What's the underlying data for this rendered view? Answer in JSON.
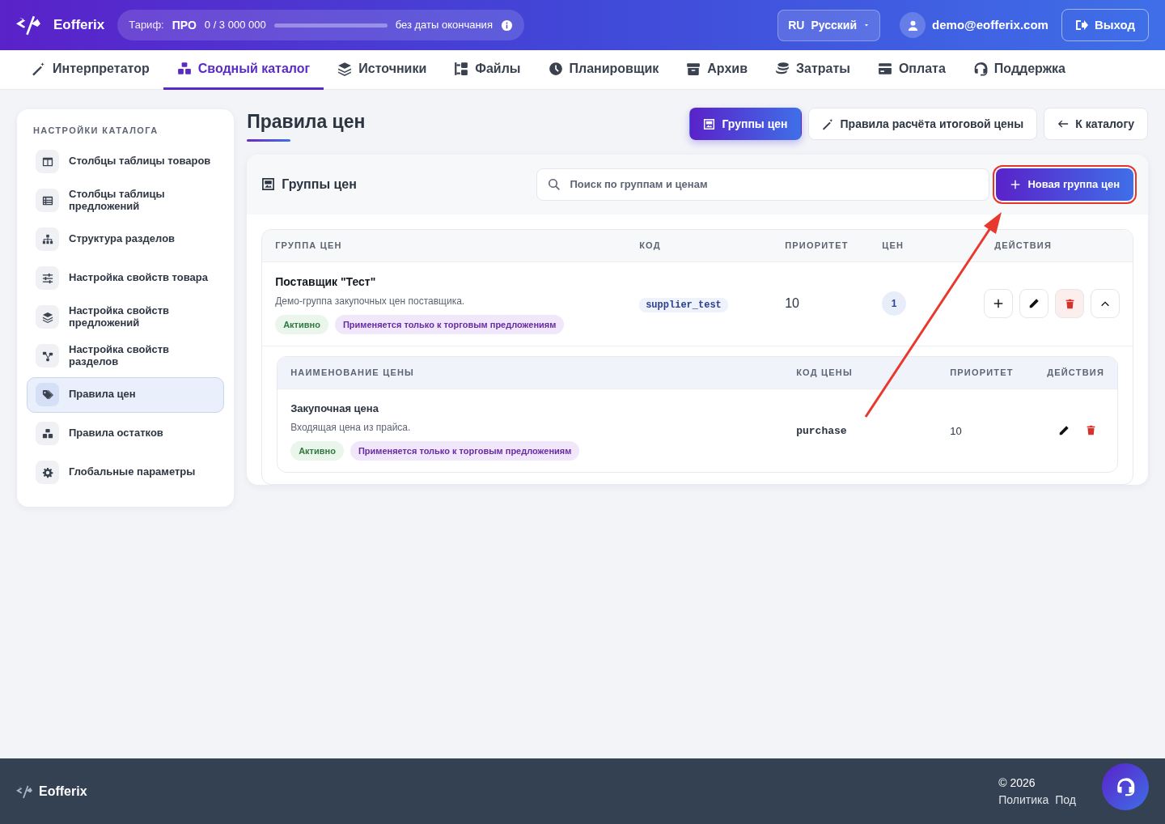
{
  "brand": "Eofferix",
  "plan": {
    "label": "Тариф:",
    "name": "ПРО",
    "usage": "0 / 3 000 000",
    "level": 0,
    "expiry": "без даты окончания"
  },
  "language": {
    "code": "RU",
    "name": "Русский"
  },
  "user": {
    "email": "demo@eofferix.com"
  },
  "logout": "Выход",
  "nav": [
    {
      "label": "Интерпретатор",
      "selected": false
    },
    {
      "label": "Сводный каталог",
      "selected": true
    },
    {
      "label": "Источники",
      "selected": false
    },
    {
      "label": "Файлы",
      "selected": false
    },
    {
      "label": "Планировщик",
      "selected": false
    },
    {
      "label": "Архив",
      "selected": false
    },
    {
      "label": "Затраты",
      "selected": false
    },
    {
      "label": "Оплата",
      "selected": false
    },
    {
      "label": "Поддержка",
      "selected": false
    }
  ],
  "sidebar": {
    "heading": "НАСТРОЙКИ КАТАЛОГА",
    "items": [
      {
        "label": "Столбцы таблицы товаров",
        "selected": false
      },
      {
        "label": "Столбцы таблицы предложений",
        "selected": false
      },
      {
        "label": "Структура разделов",
        "selected": false
      },
      {
        "label": "Настройка свойств товара",
        "selected": false
      },
      {
        "label": "Настройка свойств предложений",
        "selected": false
      },
      {
        "label": "Настройка свойств разделов",
        "selected": false
      },
      {
        "label": "Правила цен",
        "selected": true
      },
      {
        "label": "Правила остатков",
        "selected": false
      },
      {
        "label": "Глобальные параметры",
        "selected": false
      }
    ]
  },
  "page": {
    "title": "Правила цен",
    "tabs": [
      {
        "label": "Группы цен",
        "kind": "tab",
        "selected": true
      },
      {
        "label": "Правила расчёта итоговой цены",
        "kind": "tab",
        "selected": false
      },
      {
        "label": "К каталогу",
        "kind": "back",
        "selected": false
      }
    ]
  },
  "panel": {
    "title": "Группы цен",
    "search": {
      "placeholder": "Поиск по группам и ценам"
    },
    "new_button": {
      "label": "Новая группа цен",
      "highlighted": true
    }
  },
  "table": {
    "columns": [
      "ГРУППА ЦЕН",
      "КОД",
      "ПРИОРИТЕТ",
      "ЦЕН",
      "ДЕЙСТВИЯ"
    ],
    "rows": [
      {
        "name": "Поставщик \"Тест\"",
        "description": "Демо-группа закупочных цен поставщика.",
        "tags": [
          {
            "label": "Активно",
            "kind": "status"
          },
          {
            "label": "Применяется только к торговым предложениям",
            "kind": "scope"
          }
        ],
        "code": "supplier_test",
        "priority": "10",
        "count": "1",
        "expanded": true,
        "prices": {
          "columns": [
            "НАИМЕНОВАНИЕ ЦЕНЫ",
            "КОД ЦЕНЫ",
            "ПРИОРИТЕТ",
            "ДЕЙСТВИЯ"
          ],
          "rows": [
            {
              "name": "Закупочная цена",
              "description": "Входящая цена из прайса.",
              "tags": [
                {
                  "label": "Активно",
                  "kind": "status"
                },
                {
                  "label": "Применяется только к торговым предложениям",
                  "kind": "scope"
                }
              ],
              "code": "purchase",
              "priority": "10"
            }
          ]
        }
      }
    ]
  },
  "footer": {
    "brand": "Eofferix",
    "copyright": "© 2026",
    "links": [
      "Политика",
      "Под"
    ]
  }
}
